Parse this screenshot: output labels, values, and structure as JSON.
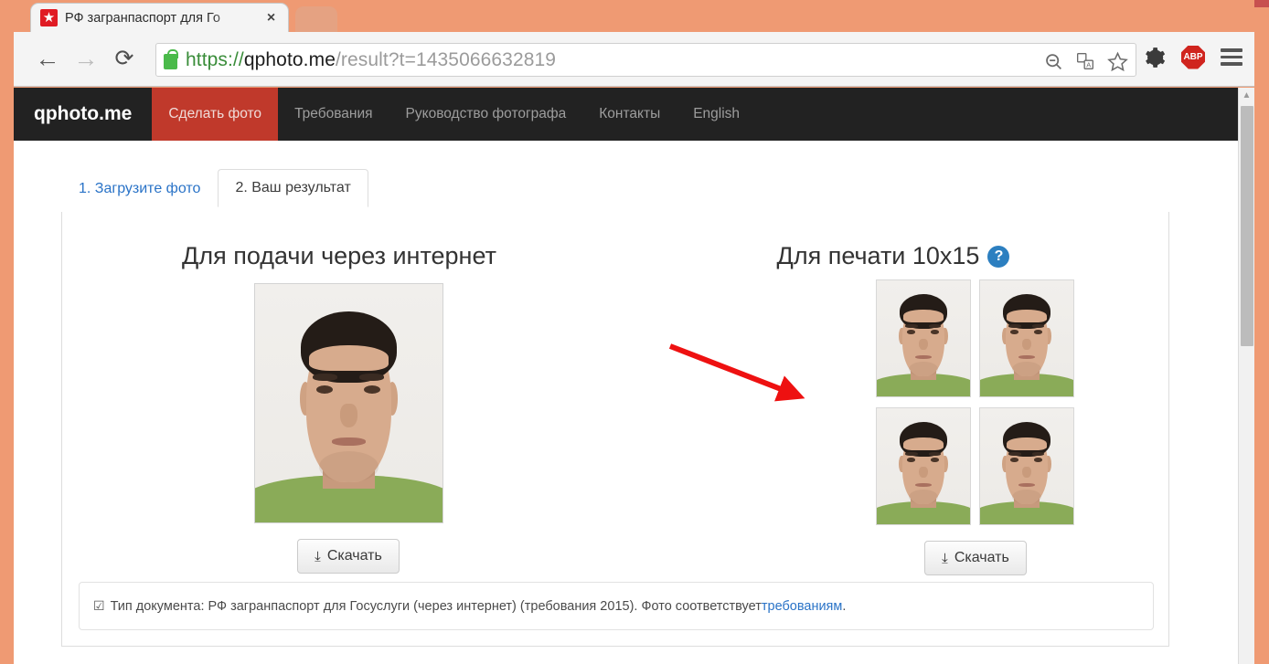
{
  "browser": {
    "tab": {
      "title": "РФ загранпаспорт для Го",
      "favicon_icon": "red-star-favicon",
      "close_icon": "×"
    },
    "nav": {
      "back_icon": "←",
      "forward_icon": "→",
      "reload_icon": "⟳"
    },
    "omnibox": {
      "lock_icon": "padlock-icon",
      "scheme": "https://",
      "host": "qphoto.me",
      "path": "/result?t=1435066632819",
      "zoom_out_icon": "⊖",
      "translate_icon": "translate-icon",
      "bookmark_icon": "☆"
    },
    "toolbar_right": {
      "settings_icon": "⚙",
      "adblock_label": "ABP",
      "menu_icon": "hamburger-icon"
    },
    "scrollbar": {
      "up_arrow": "▲"
    }
  },
  "site": {
    "brand": "qphoto.me",
    "nav_items": [
      {
        "label": "Сделать фото",
        "active": true
      },
      {
        "label": "Требования",
        "active": false
      },
      {
        "label": "Руководство фотографа",
        "active": false
      },
      {
        "label": "Контакты",
        "active": false
      },
      {
        "label": "English",
        "active": false
      }
    ]
  },
  "page": {
    "tabs": [
      {
        "label": "1. Загрузите фото",
        "active": false
      },
      {
        "label": "2. Ваш результат",
        "active": true
      }
    ],
    "left_column": {
      "heading": "Для подачи через интернет",
      "download_label": "Скачать",
      "download_icon": "download-icon"
    },
    "right_column": {
      "heading": "Для печати 10x15",
      "help_icon": "?",
      "download_label": "Скачать",
      "download_icon": "download-icon",
      "photo_count": 4
    },
    "notice": {
      "check_icon": "☑",
      "text": "Тип документа: РФ загранпаспорт для Госуслуги (через интернет) (требования 2015). Фото соответствует ",
      "link": "требованиям",
      "suffix": "."
    },
    "annotation": {
      "type": "red-arrow",
      "color": "#ee1111",
      "points_to": "Для печати 10x15"
    }
  },
  "colors": {
    "accent_red": "#c0392b",
    "nav_dark": "#222222",
    "link_blue": "#2a73c7",
    "help_blue": "#2c7fc0",
    "desktop": "#ef9a73"
  }
}
